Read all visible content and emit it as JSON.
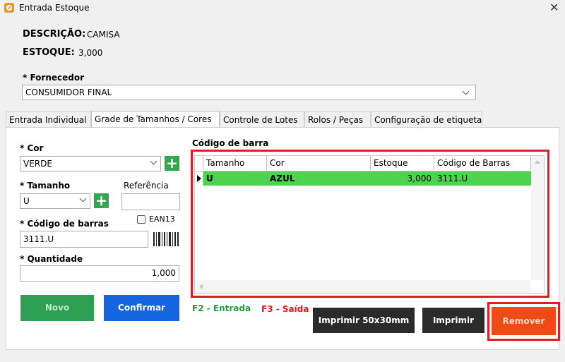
{
  "window": {
    "title": "Entrada Estoque",
    "close_glyph": "✕"
  },
  "header": {
    "descricao_label": "DESCRIÇÃO:",
    "descricao_value": "CAMISA",
    "estoque_label": "ESTOQUE:",
    "estoque_value": "3,000"
  },
  "fornecedor": {
    "label": "* Fornecedor",
    "value": "CONSUMIDOR FINAL"
  },
  "tabs": [
    {
      "label": "Entrada Individual",
      "active": false
    },
    {
      "label": "Grade de Tamanhos / Cores",
      "active": true
    },
    {
      "label": "Controle de Lotes",
      "active": false
    },
    {
      "label": "Rolos / Peças",
      "active": false
    },
    {
      "label": "Configuração de etiqueta",
      "active": false
    }
  ],
  "form": {
    "cor_label": "* Cor",
    "cor_value": "VERDE",
    "tamanho_label": "* Tamanho",
    "tamanho_value": "U",
    "referencia_label": "Referência",
    "referencia_value": "",
    "codigo_label": "* Código de barras",
    "codigo_value": "3111.U",
    "ean13_label": "EAN13",
    "ean13_checked": false,
    "quantidade_label": "* Quantidade",
    "quantidade_value": "1,000",
    "plus_glyph": "+"
  },
  "search": {
    "label": "Código de barras",
    "value": ""
  },
  "grid": {
    "columns": [
      "Tamanho",
      "Cor",
      "Estoque",
      "Código de Barras"
    ],
    "rows": [
      {
        "tamanho": "U",
        "cor": "AZUL",
        "estoque": "3,000",
        "codigo": "3111.U"
      }
    ],
    "row_color": "#4dd34d"
  },
  "shortcuts": {
    "entrada": "F2 - Entrada",
    "saida": "F3 - Saída"
  },
  "buttons": {
    "novo": "Novo",
    "confirmar": "Confirmar",
    "imprimir_50x30": "Imprimir 50x30mm",
    "imprimir": "Imprimir",
    "remover": "Remover"
  },
  "colors": {
    "novo_bg": "#2e9e52",
    "confirmar_bg": "#1565e0",
    "dark_btn_bg": "#2b2b2b",
    "remover_bg": "#f04a16",
    "highlight_frame": "#e41b23",
    "entrada_text": "#1f9e3e",
    "saida_text": "#e01818"
  }
}
